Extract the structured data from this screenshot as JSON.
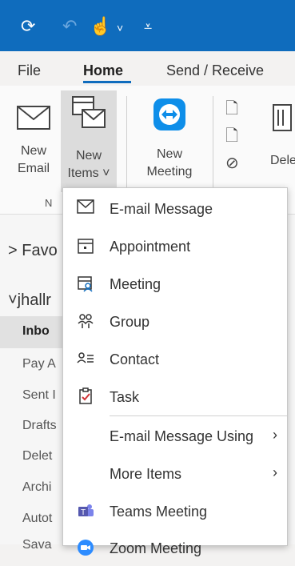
{
  "colors": {
    "accent": "#0f6cbd",
    "teams": "#5558af",
    "task_check": "#d13438"
  },
  "quick_access": {
    "icons": [
      "sync-icon",
      "undo-icon",
      "touch-mode-icon",
      "chevron-down-icon",
      "customize-icon"
    ]
  },
  "tabs": [
    {
      "label": "File"
    },
    {
      "label": "Home",
      "active": true
    },
    {
      "label": "Send / Receive"
    }
  ],
  "ribbon": {
    "new_email": {
      "line1": "New",
      "line2": "Email"
    },
    "new_items": {
      "line1": "New",
      "line2": "Items ˅"
    },
    "new_meeting": {
      "line1": "New",
      "line2": "Meeting"
    },
    "delete_label": "Dele",
    "group_label": "N"
  },
  "folders": {
    "favorites": "> Favo",
    "account": "˅jhallr",
    "items": [
      "Inbo",
      "Pay A",
      "Sent I",
      "Drafts",
      "Delet",
      "Archi",
      "Autot",
      "Sava"
    ]
  },
  "menu": {
    "items": [
      {
        "label": "E-mail Message",
        "icon": "mail-icon"
      },
      {
        "label": "Appointment",
        "icon": "calendar-icon"
      },
      {
        "label": "Meeting",
        "icon": "meeting-icon"
      },
      {
        "label": "Group",
        "icon": "group-icon"
      },
      {
        "label": "Contact",
        "icon": "contact-icon"
      },
      {
        "label": "Task",
        "icon": "task-icon"
      },
      {
        "label": "E-mail Message Using",
        "submenu": true
      },
      {
        "label": "More Items",
        "submenu": true
      },
      {
        "label": "Teams Meeting",
        "icon": "teams-icon"
      },
      {
        "label": "Zoom Meeting",
        "icon": "zoom-icon"
      }
    ]
  }
}
